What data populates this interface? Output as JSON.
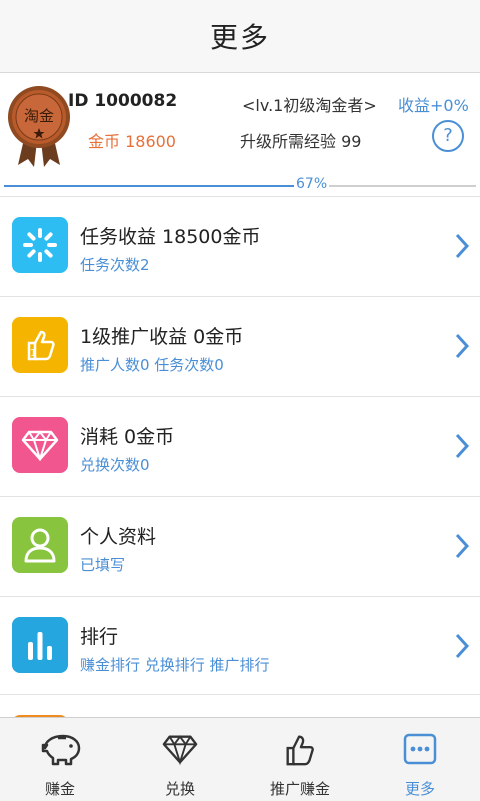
{
  "header": {
    "title": "更多"
  },
  "profile": {
    "medal_text": "淘金",
    "id_label": "ID 1000082",
    "level_label": "<lv.1初级淘金者>",
    "yield_label": "收益+0%",
    "coins_label": "金币 18600",
    "exp_label": "升级所需经验 99",
    "help_symbol": "?"
  },
  "progress": {
    "value": 0.67,
    "label": "67%"
  },
  "menu": [
    {
      "title": "任务收益 18500金币",
      "subtitle": "任务次数2",
      "icon": "loading-spinner-icon",
      "color": "#2dbdf2"
    },
    {
      "title": "1级推广收益 0金币",
      "subtitle": "推广人数0 任务次数0",
      "icon": "thumbs-up-icon",
      "color": "#f5b400"
    },
    {
      "title": "消耗 0金币",
      "subtitle": "兑换次数0",
      "icon": "diamond-icon",
      "color": "#f2568f"
    },
    {
      "title": "个人资料",
      "subtitle": "已填写",
      "icon": "person-icon",
      "color": "#88c43d"
    },
    {
      "title": "排行",
      "subtitle": "赚金排行 兑换排行 推广排行",
      "icon": "bar-chart-icon",
      "color": "#25a6de"
    }
  ],
  "tabs": [
    {
      "label": "赚金",
      "icon": "piggy-bank-icon"
    },
    {
      "label": "兑换",
      "icon": "diamond-icon"
    },
    {
      "label": "推广赚金",
      "icon": "thumbs-up-icon"
    },
    {
      "label": "更多",
      "icon": "more-icon",
      "active": true
    }
  ],
  "colors": {
    "accent": "#4a8fd6",
    "coins": "#e8703a"
  }
}
